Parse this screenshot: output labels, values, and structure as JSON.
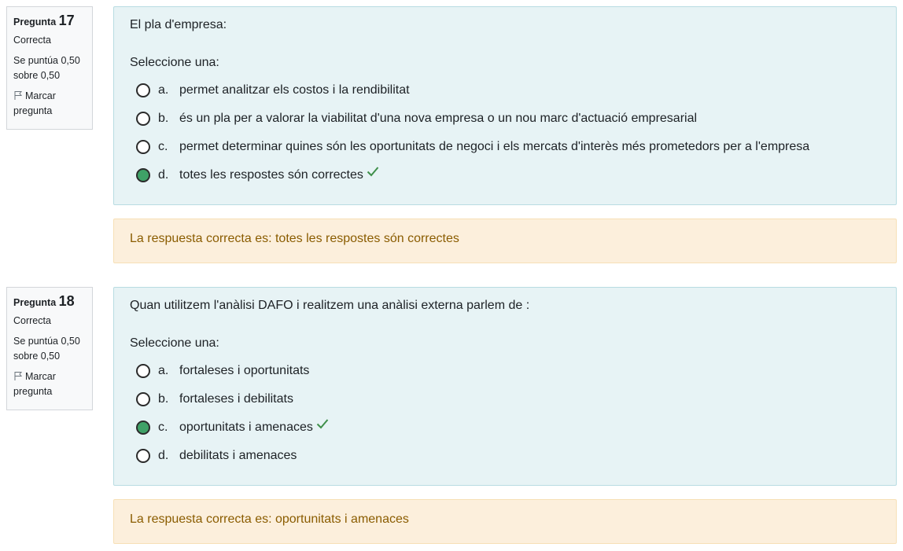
{
  "questions": [
    {
      "label": "Pregunta",
      "number": "17",
      "state": "Correcta",
      "grade_line1": "Se puntúa 0,50",
      "grade_line2": "sobre 0,50",
      "flag_line1": "Marcar",
      "flag_line2": "pregunta",
      "text": "El pla d'empresa:",
      "prompt": "Seleccione una:",
      "answers": [
        {
          "letter": "a.",
          "text": "permet analitzar els costos i la rendibilitat",
          "selected": false
        },
        {
          "letter": "b.",
          "text": "és un pla per a valorar la viabilitat d'una nova empresa o un nou marc d'actuació empresarial",
          "selected": false
        },
        {
          "letter": "c.",
          "text": "permet determinar quines són les oportunitats de negoci i els mercats d'interès més prometedors per a l'empresa",
          "selected": false
        },
        {
          "letter": "d.",
          "text": "totes les respostes són correctes",
          "selected": true
        }
      ],
      "feedback": "La respuesta correcta es: totes les respostes són correctes"
    },
    {
      "label": "Pregunta",
      "number": "18",
      "state": "Correcta",
      "grade_line1": "Se puntúa 0,50",
      "grade_line2": "sobre 0,50",
      "flag_line1": "Marcar",
      "flag_line2": "pregunta",
      "text": "Quan utilitzem l'anàlisi DAFO i realitzem una anàlisi externa parlem de :",
      "prompt": "Seleccione una:",
      "answers": [
        {
          "letter": "a.",
          "text": "fortaleses i oportunitats",
          "selected": false
        },
        {
          "letter": "b.",
          "text": "fortaleses i debilitats",
          "selected": false
        },
        {
          "letter": "c.",
          "text": "oportunitats i amenaces",
          "selected": true
        },
        {
          "letter": "d.",
          "text": "debilitats i amenaces",
          "selected": false
        }
      ],
      "feedback": "La respuesta correcta es: oportunitats i amenaces"
    }
  ],
  "colors": {
    "correct_radio": "#3fa167",
    "check": "#3f8f4a",
    "content_bg": "#e7f3f5",
    "feedback_bg": "#fcefdc",
    "feedback_text": "#8a5c00"
  },
  "icons": {
    "flag": "flag-icon",
    "correct": "check-icon"
  }
}
